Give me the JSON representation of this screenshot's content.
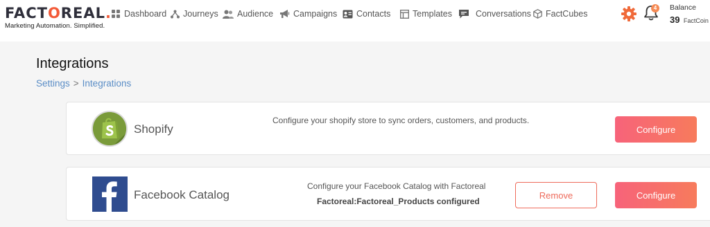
{
  "brand": {
    "name_prefix": "FACT",
    "name_mark": "O",
    "name_suffix": "REAL",
    "name_dot": ".",
    "tagline": "Marketing Automation. Simplified."
  },
  "nav": [
    {
      "label": "Dashboard",
      "icon": "dashboard-icon"
    },
    {
      "label": "Journeys",
      "icon": "journeys-icon"
    },
    {
      "label": "Audience",
      "icon": "audience-icon"
    },
    {
      "label": "Campaigns",
      "icon": "megaphone-icon"
    },
    {
      "label": "Contacts",
      "icon": "contacts-icon"
    },
    {
      "label": "Templates",
      "icon": "templates-icon"
    },
    {
      "label": "Conversations",
      "icon": "chat-icon"
    },
    {
      "label": "FactCubes",
      "icon": "cube-icon"
    }
  ],
  "header": {
    "notification_count": "4",
    "balance_label": "Balance",
    "balance_value": "39",
    "balance_unit": "FactCoin"
  },
  "page": {
    "title": "Integrations",
    "breadcrumb": [
      "Settings",
      "Integrations"
    ],
    "breadcrumb_separator": ">"
  },
  "integrations": [
    {
      "name": "Shopify",
      "description": "Configure your shopify store to sync orders, customers, and products.",
      "status": "",
      "configure_label": "Configure"
    },
    {
      "name": "Facebook Catalog",
      "description": "Configure your Facebook Catalog with Factoreal",
      "status": "Factoreal:Factoreal_Products configured",
      "remove_label": "Remove",
      "configure_label": "Configure"
    }
  ],
  "colors": {
    "accent": "#f7637a",
    "link": "#5a8dc6",
    "gear": "#f06a3a",
    "shopify_bg": "#7a9b3a",
    "facebook_bg": "#2f4c8f"
  }
}
